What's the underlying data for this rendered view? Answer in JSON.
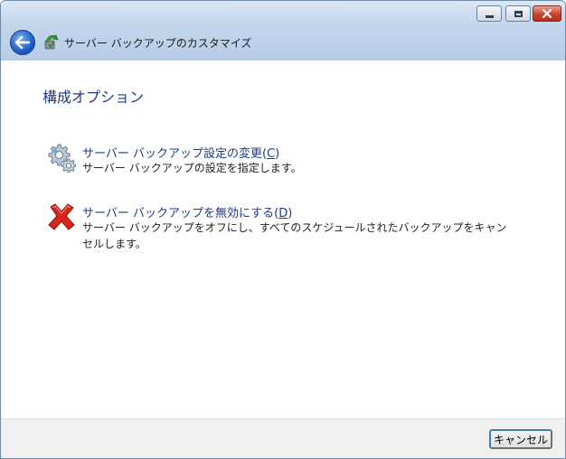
{
  "window": {
    "title": "サーバー バックアップのカスタマイズ",
    "controls": {
      "minimize": "minimize",
      "maximize": "maximize",
      "close": "close"
    }
  },
  "page": {
    "heading": "構成オプション"
  },
  "options": [
    {
      "title": "サーバー バックアップ設定の変更(",
      "access_key": "C",
      "title_suffix": ")",
      "description": "サーバー バックアップの設定を指定します。",
      "icon": "gears-icon"
    },
    {
      "title": "サーバー バックアップを無効にする(",
      "access_key": "D",
      "title_suffix": ")",
      "description": "サーバー バックアップをオフにし、すべてのスケジュールされたバックアップをキャンセルします。",
      "icon": "red-x-icon"
    }
  ],
  "footer": {
    "cancel_label": "キャンセル"
  },
  "colors": {
    "link": "#1e3a8a",
    "titlebar": "#c2d5ec",
    "close_button": "#c9432c"
  }
}
